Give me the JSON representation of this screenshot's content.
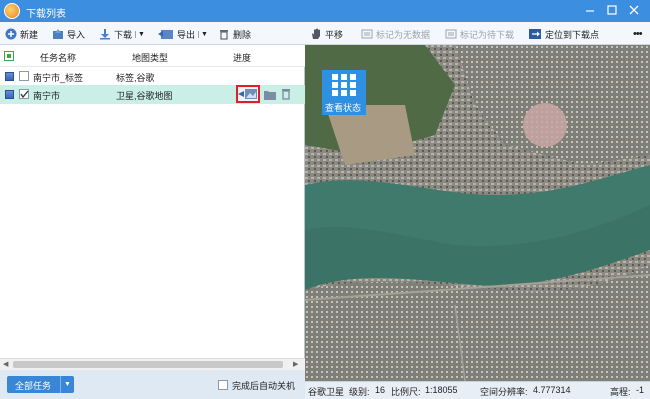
{
  "window": {
    "title": "下载列表"
  },
  "toolbar": {
    "new_label": "新建",
    "import_label": "导入",
    "download_label": "下载",
    "export_label": "导出",
    "delete_label": "删除"
  },
  "columns": {
    "name": "任务名称",
    "map_type": "地图类型",
    "progress": "进度"
  },
  "tasks": [
    {
      "name": "南宁市_标签",
      "map_type": "标签,谷歌",
      "checked": false
    },
    {
      "name": "南宁市",
      "map_type": "卫星,谷歌地图",
      "checked": true
    }
  ],
  "bottom": {
    "all_tasks_label": "全部任务",
    "auto_shutdown_label": "完成后自动关机"
  },
  "map_toolbar": {
    "pan_label": "平移",
    "mark_no_data_label": "标记为无数据",
    "mark_pending_label": "标记为待下载",
    "locate_label": "定位到下载点"
  },
  "overlay": {
    "view_status_label": "查看状态"
  },
  "status_bar": {
    "source": "谷歌卫星",
    "level_label": "级别:",
    "level_value": "16",
    "scale_label": "比例尺:",
    "scale_value": "1:18055",
    "resolution_label": "空间分辨率:",
    "resolution_value": "4.777314",
    "elevation_label": "高程:",
    "elevation_value": "-1"
  },
  "colors": {
    "titlebar": "#3c8ee0",
    "selected_row": "#c9efe7",
    "highlight_box": "#e02020",
    "accent_button": "#3a86d6",
    "overlay_tile": "#2f8fe0"
  }
}
